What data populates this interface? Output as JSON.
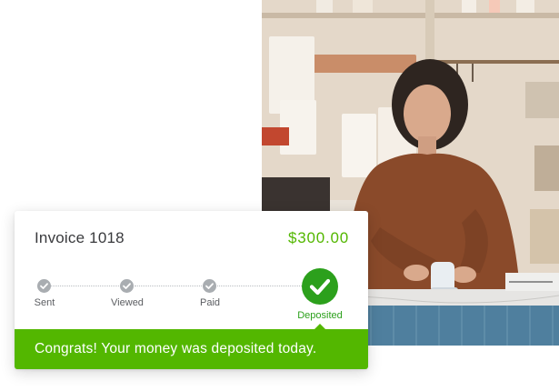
{
  "invoice": {
    "title": "Invoice 1018",
    "amount": "$300.00"
  },
  "progress": {
    "steps": [
      {
        "label": "Sent",
        "state": "complete"
      },
      {
        "label": "Viewed",
        "state": "complete"
      },
      {
        "label": "Paid",
        "state": "complete"
      },
      {
        "label": "Deposited",
        "state": "current"
      }
    ]
  },
  "banner": {
    "message": "Congrats! Your money was deposited today."
  },
  "colors": {
    "accent_green": "#53b700",
    "deposited_green": "#2ca01c",
    "step_gray": "#a9adb1"
  }
}
